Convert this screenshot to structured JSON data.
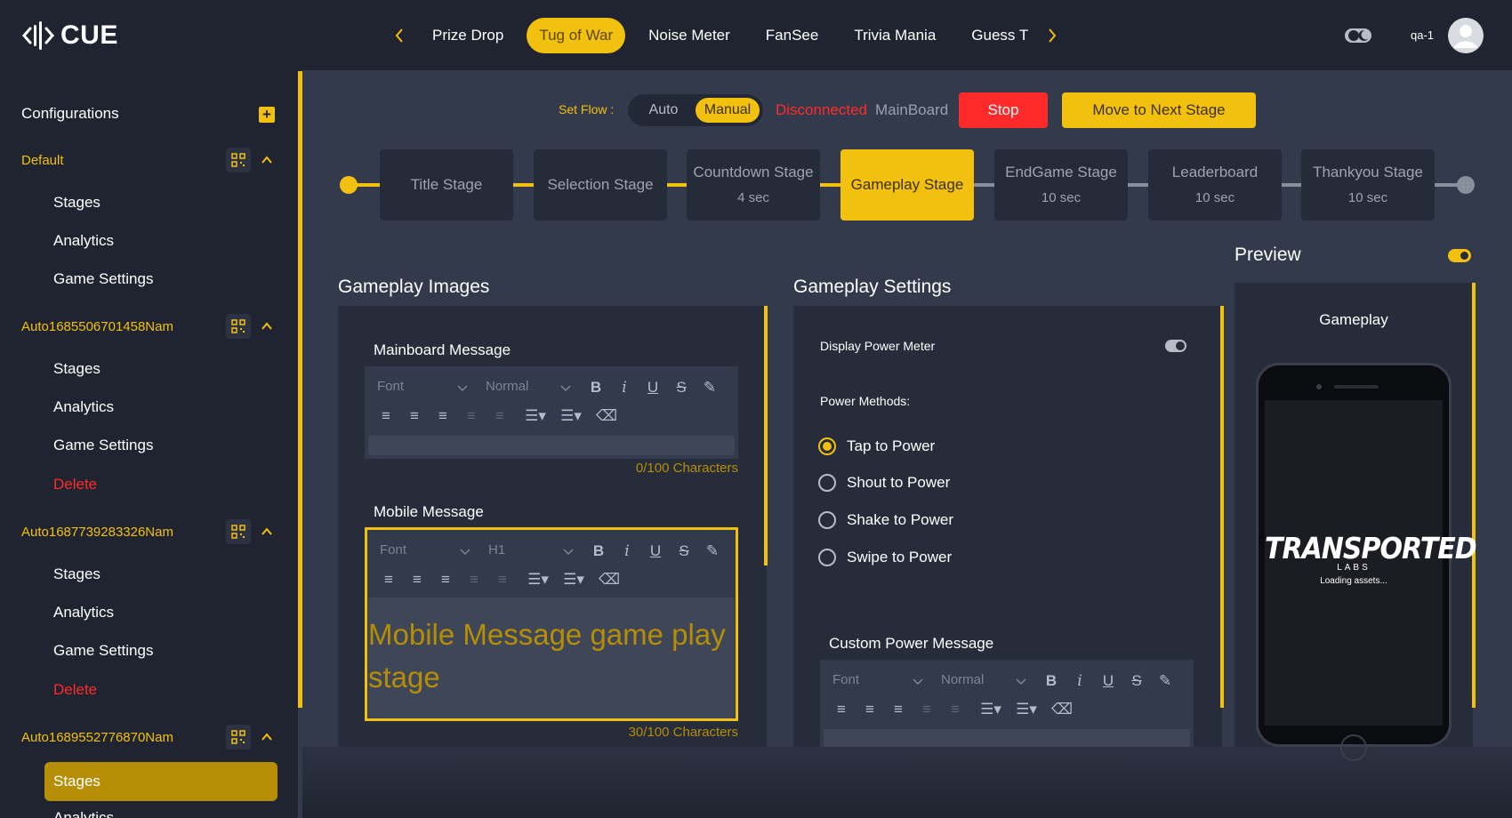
{
  "app": {
    "name": "CUE"
  },
  "header": {
    "games": [
      "Prize Drop",
      "Tug of War",
      "Noise Meter",
      "FanSee",
      "Trivia Mania",
      "Guess T"
    ],
    "active_game": "Tug of War",
    "username": "qa-1"
  },
  "sidebar": {
    "title": "Configurations",
    "groups": [
      {
        "name": "Default",
        "items": [
          "Stages",
          "Analytics",
          "Game Settings"
        ]
      },
      {
        "name": "Auto1685506701458Nam",
        "items": [
          "Stages",
          "Analytics",
          "Game Settings",
          "Delete"
        ]
      },
      {
        "name": "Auto1687739283326Nam",
        "items": [
          "Stages",
          "Analytics",
          "Game Settings",
          "Delete"
        ]
      },
      {
        "name": "Auto1689552776870Nam",
        "items": [
          "Stages",
          "Analytics"
        ]
      }
    ],
    "active_item": "Stages"
  },
  "flow": {
    "label": "Set Flow :",
    "options": [
      "Auto",
      "Manual"
    ],
    "selected": "Manual",
    "connection_status": "Disconnected",
    "connection_target": "MainBoard",
    "stop_label": "Stop",
    "next_label": "Move to Next Stage"
  },
  "stages": [
    {
      "name": "Title Stage",
      "time": ""
    },
    {
      "name": "Selection Stage",
      "time": ""
    },
    {
      "name": "Countdown Stage",
      "time": "4 sec"
    },
    {
      "name": "Gameplay Stage",
      "time": ""
    },
    {
      "name": "EndGame Stage",
      "time": "10 sec"
    },
    {
      "name": "Leaderboard",
      "time": "10 sec"
    },
    {
      "name": "Thankyou Stage",
      "time": "10 sec"
    }
  ],
  "active_stage": "Gameplay Stage",
  "images": {
    "title": "Gameplay Images",
    "mainboard": {
      "label": "Mainboard Message",
      "font": "Font",
      "size": "Normal",
      "text": "",
      "count": "0/100 Characters"
    },
    "mobile": {
      "label": "Mobile Message",
      "font": "Font",
      "size": "H1",
      "text": "Mobile Message game play stage",
      "count": "30/100 Characters"
    }
  },
  "settings": {
    "title": "Gameplay Settings",
    "power_meter_label": "Display Power Meter",
    "power_meter_on": false,
    "power_methods_label": "Power Methods:",
    "methods": [
      "Tap to Power",
      "Shout to Power",
      "Shake to Power",
      "Swipe to Power"
    ],
    "selected_method": "Tap to Power",
    "custom_label": "Custom Power Message",
    "custom_font": "Font",
    "custom_size": "Normal"
  },
  "preview": {
    "title": "Preview",
    "label": "Gameplay",
    "enabled": true,
    "brand": "TRANSPORTED",
    "brand_sub": "LABS",
    "loading": "Loading assets..."
  },
  "colors": {
    "accent": "#f2c10f",
    "danger": "#ff2b2b",
    "bg": "#1f2430",
    "panel": "#323a4c"
  }
}
